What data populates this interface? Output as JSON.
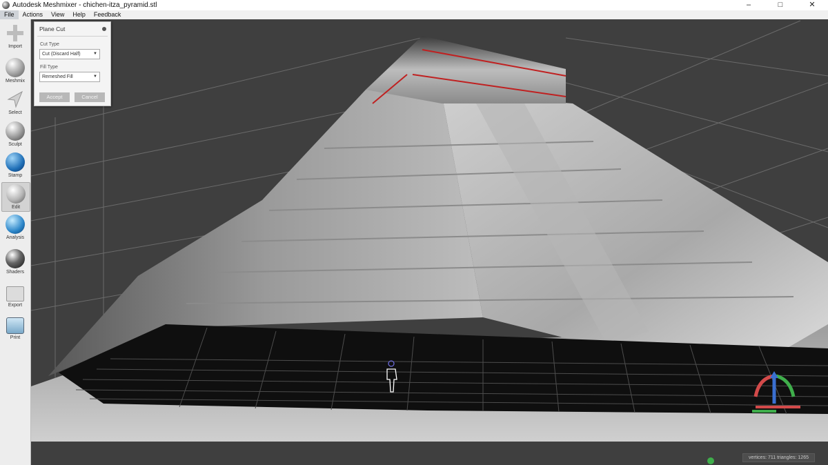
{
  "window": {
    "title": "Autodesk Meshmixer - chichen-itza_pyramid.stl",
    "controls": [
      "–",
      "□",
      "✕"
    ]
  },
  "menu": [
    {
      "label": "File",
      "active": true
    },
    {
      "label": "Actions"
    },
    {
      "label": "View"
    },
    {
      "label": "Help"
    },
    {
      "label": "Feedback"
    }
  ],
  "toolbar": {
    "items": [
      {
        "label": "Import",
        "icon": "plus-icon"
      },
      {
        "label": "Meshmix",
        "icon": "meshmix-icon"
      },
      {
        "label": "Select",
        "icon": "select-arrow-icon"
      },
      {
        "label": "Sculpt",
        "icon": "sculpt-brush-icon"
      },
      {
        "label": "Stamp",
        "icon": "stamp-icon"
      },
      {
        "label": "Edit",
        "icon": "edit-icon",
        "selected": true
      },
      {
        "label": "Analysis",
        "icon": "analysis-icon"
      },
      {
        "label": "Shaders",
        "icon": "shaders-sphere-icon"
      },
      {
        "label": "Export",
        "icon": "export-icon"
      },
      {
        "label": "Print",
        "icon": "print-icon"
      }
    ]
  },
  "panel": {
    "title": "Plane Cut",
    "cut_type_label": "Cut Type",
    "cut_type_value": "Cut (Discard Half)",
    "fill_type_label": "Fill Type",
    "fill_type_value": "Remeshed Fill",
    "accept_label": "Accept",
    "cancel_label": "Cancel"
  },
  "status": {
    "text": "vertices: 711 triangles: 1265"
  },
  "colors": {
    "viewport_bg": "#3f3f3f",
    "toolbar_bg": "#ededed",
    "cut_line": "#c02020",
    "gizmo_red": "#d24a4a",
    "gizmo_green": "#3fae4b",
    "gizmo_blue": "#3a6fd0"
  }
}
